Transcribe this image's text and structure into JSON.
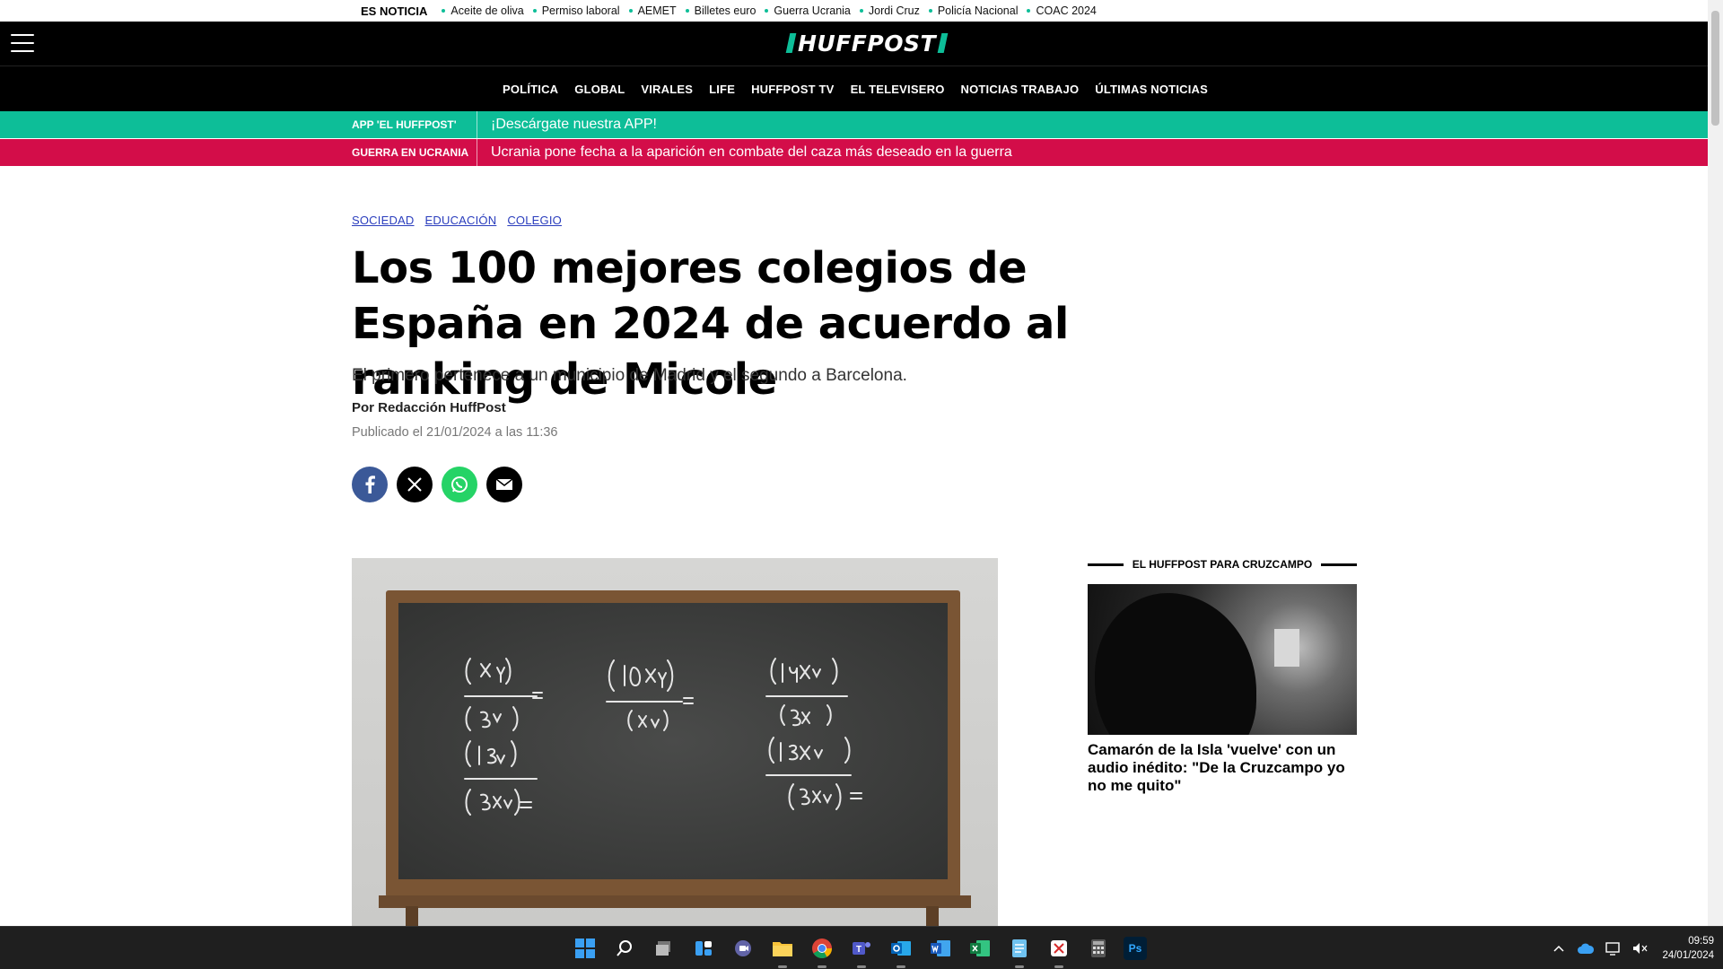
{
  "topbar": {
    "label": "ES NOTICIA",
    "items": [
      "Aceite de oliva",
      "Permiso laboral",
      "AEMET",
      "Billetes euro",
      "Guerra Ucrania",
      "Jordi Cruz",
      "Policía Nacional",
      "COAC 2024"
    ]
  },
  "header": {
    "logo_text": "HUFFPOST",
    "nav": [
      "POLÍTICA",
      "GLOBAL",
      "VIRALES",
      "LIFE",
      "HUFFPOST TV",
      "EL TELEVISERO",
      "NOTICIAS TRABAJO",
      "ÚLTIMAS NOTICIAS"
    ]
  },
  "strips": {
    "app_tag": "APP 'EL HUFFPOST'",
    "app_msg": "¡Descárgate nuestra APP!",
    "war_tag": "GUERRA EN UCRANIA",
    "war_msg": "Ucrania pone fecha a la aparición en combate del caza más deseado en la guerra"
  },
  "article": {
    "tags": [
      "SOCIEDAD",
      "EDUCACIÓN",
      "COLEGIO"
    ],
    "headline": "Los 100 mejores colegios de España en 2024 de acuerdo al ranking de Micole",
    "subtitle": "El primero pertenece a un municipio de Madrid y el segundo a Barcelona.",
    "byline": "Por Redacción HuffPost",
    "published": "Publicado el 21/01/2024 a las 11:36"
  },
  "sidebar": {
    "heading": "EL HUFFPOST PARA CRUZCAMPO",
    "title": "Camarón de la Isla 'vuelve' con un audio inédito: \"De la Cruzcampo yo no me quito\""
  },
  "taskbar": {
    "apps": [
      "windows-start",
      "search",
      "task-view",
      "widgets",
      "teams-chat",
      "file-explorer",
      "chrome",
      "teams",
      "outlook",
      "word",
      "excel",
      "notepad",
      "snipping-tool",
      "calculator",
      "photoshop"
    ],
    "photoshop_label": "Ps",
    "time": "09:59",
    "date": "24/01/2024"
  },
  "colors": {
    "accent_green": "#0dbe98",
    "accent_red": "#d30d49",
    "link_blue": "#2a3dbd"
  }
}
